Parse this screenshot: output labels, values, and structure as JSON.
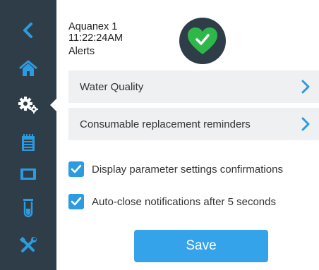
{
  "device": {
    "name": "Aquanex 1",
    "time": "11:22:24AM",
    "section": "Alerts"
  },
  "status": {
    "icon": "check-heart-icon",
    "color": "#2eb84a"
  },
  "sidebar": {
    "items": [
      {
        "icon": "back-chevron-icon"
      },
      {
        "icon": "home-icon"
      },
      {
        "icon": "gears-icon",
        "active": true
      },
      {
        "icon": "notepad-icon"
      },
      {
        "icon": "display-panel-icon"
      },
      {
        "icon": "test-tube-icon"
      },
      {
        "icon": "tools-icon"
      }
    ]
  },
  "menu": {
    "items": [
      {
        "label": "Water Quality"
      },
      {
        "label": "Consumable replacement reminders"
      }
    ]
  },
  "options": [
    {
      "label": "Display parameter settings confirmations",
      "checked": true
    },
    {
      "label": "Auto-close notifications after 5 seconds",
      "checked": true
    }
  ],
  "save_label": "Save",
  "colors": {
    "sidebar": "#2e3d47",
    "accent": "#2d9be0",
    "button": "#35a3ea",
    "row_bg": "#eef0f1"
  }
}
